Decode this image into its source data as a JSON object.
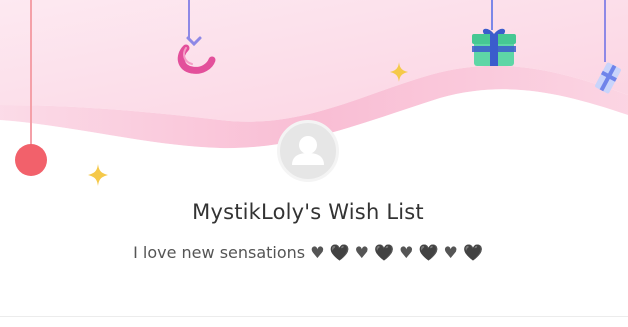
{
  "profile": {
    "title": "MystikLoly's Wish List",
    "bio": "I love new sensations ♥ 🖤 ♥ 🖤 ♥ 🖤 ♥ 🖤",
    "avatar_icon": "user-placeholder-icon"
  },
  "theme": {
    "wave_light": "#fde6ef",
    "wave_mid": "#fbd0e0",
    "wave_deep": "#f7a8c6",
    "ornament_red": "#f2616b",
    "sparkle_gold": "#f5c94a",
    "gift_green": "#5ed6a6",
    "gift_ribbon": "#3b5ccc"
  },
  "decorations": [
    "red-ornament-icon",
    "sparkle-icon",
    "ribbon-icon",
    "gift-box-icon",
    "small-gift-icon"
  ]
}
